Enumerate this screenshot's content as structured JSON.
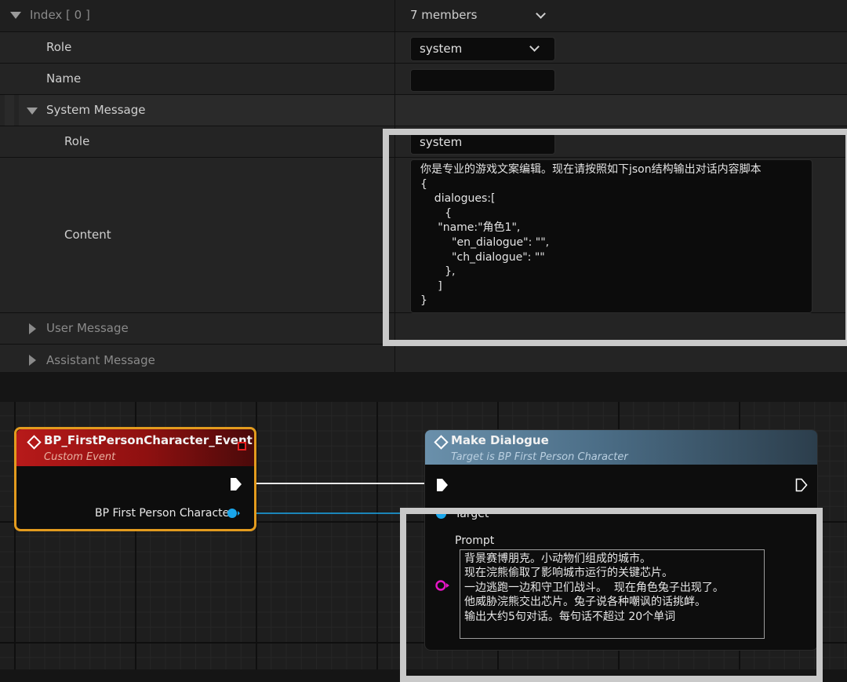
{
  "details": {
    "index_label": "Index [ 0 ]",
    "index_value": "7 members",
    "role_label": "Role",
    "role_value": "system",
    "name_label": "Name",
    "name_value": "",
    "system_message_label": "System Message",
    "sys_role_label": "Role",
    "sys_role_value": "system",
    "content_label": "Content",
    "content_value": "你是专业的游戏文案编辑。现在请按照如下json结构输出对话内容脚本\n{\n    dialogues:[\n       {\n     \"name:\"角色1\",\n         \"en_dialogue\": \"\",\n         \"ch_dialogue\": \"\"\n       },\n     ]\n}",
    "user_message_label": "User Message",
    "assistant_message_label": "Assistant Message"
  },
  "graph": {
    "event_node": {
      "title": "BP_FirstPersonCharacter_Event",
      "subtitle": "Custom Event",
      "output_pin_label": "BP First Person Character"
    },
    "dialogue_node": {
      "title": "Make Dialogue",
      "subtitle": "Target is BP First Person Character",
      "target_label": "Target",
      "prompt_label": "Prompt",
      "prompt_value": "背景赛博朋克。小动物们组成的城市。\n现在浣熊偷取了影响城市运行的关键芯片。\n一边逃跑一边和守卫们战斗。  现在角色兔子出现了。\n他威胁浣熊交出芯片。兔子说各种嘲讽的话挑衅。\n输出大约5句对话。每句话不超过 20个单词"
    }
  },
  "colors": {
    "event_header": "#a51414",
    "event_border": "#e39b1e",
    "function_header": "#4d6f88",
    "object_pin": "#1aa7ec",
    "string_pin": "#e616c6",
    "highlight": "#c9c9c9"
  }
}
